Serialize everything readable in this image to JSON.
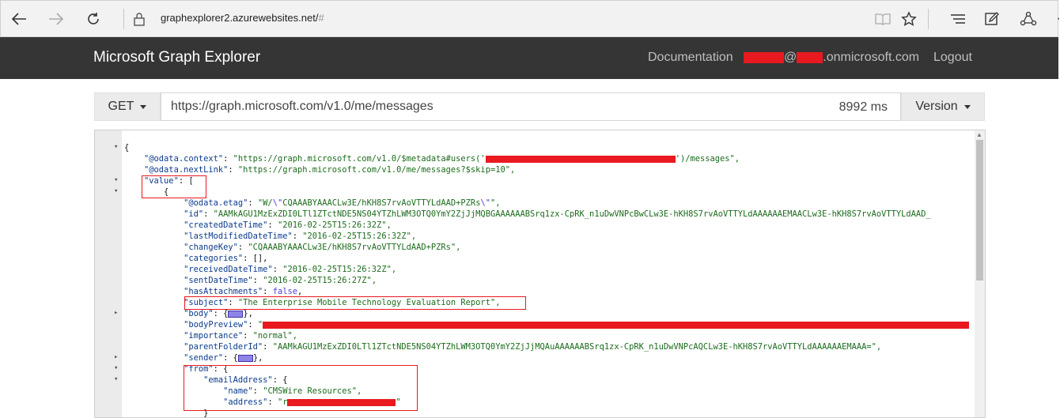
{
  "browser": {
    "url_host": "graphexplorer2.azurewebsites.net/",
    "url_hash": "#"
  },
  "header": {
    "brand": "Microsoft Graph Explorer",
    "documentation": "Documentation",
    "user_at": "@",
    "user_domain": ".onmicrosoft.com",
    "logout": "Logout"
  },
  "query": {
    "method": "GET",
    "url": "https://graph.microsoft.com/v1.0/me/messages",
    "timing": "8992 ms",
    "version": "Version"
  },
  "colors": {
    "header_bg": "#353535",
    "redaction": "#e8191f",
    "annotation": "#e8191f"
  },
  "json": {
    "open_brace": "{",
    "context_key": "\"@odata.context\"",
    "context_val_a": "\"https://graph.microsoft.com/v1.0/$metadata#users('",
    "context_val_b": "')/messages\",",
    "nextlink_key": "\"@odata.nextLink\"",
    "nextlink_val": "\"https://graph.microsoft.com/v1.0/me/messages?$skip=10\",",
    "value_key": "\"value\"",
    "value_open": ": [",
    "item_open": "{",
    "etag_key": "\"@odata.etag\"",
    "etag_val_a": "\"W/",
    "etag_val_b": "\\\"",
    "etag_val_c": "CQAAABYAAACLw3E/hKH8S7rvAoVTTYLdAAD+PZRs",
    "etag_val_d": "\\\"",
    "etag_val_e": "\",",
    "id_key": "\"id\"",
    "id_val": "\"AAMkAGU1MzExZDI0LTl1ZTctNDE5NS04YTZhLWM3OTQ0YmY2ZjJjMQBGAAAAAABSrq1zx-CpRK_n1uDwVNPcBwCLw3E-hKH8S7rvAoVTTYLdAAAAAAEMAACLw3E-hKH8S7rvAoVTTYLdAAD_",
    "created_key": "\"createdDateTime\"",
    "created_val": "\"2016-02-25T15:26:32Z\",",
    "modified_key": "\"lastModifiedDateTime\"",
    "modified_val": "\"2016-02-25T15:26:32Z\",",
    "changekey_key": "\"changeKey\"",
    "changekey_val": "\"CQAAABYAAACLw3E/hKH8S7rvAoVTTYLdAAD+PZRs\",",
    "categories_key": "\"categories\"",
    "categories_val": "[],",
    "received_key": "\"receivedDateTime\"",
    "received_val": "\"2016-02-25T15:26:32Z\",",
    "sent_key": "\"sentDateTime\"",
    "sent_val": "\"2016-02-25T15:26:27Z\",",
    "attach_key": "\"hasAttachments\"",
    "attach_val": "false",
    "subject_key": "\"subject\"",
    "subject_val": "\"The Enterprise Mobile Technology Evaluation Report\",",
    "body_key": "\"body\"",
    "preview_key": "\"bodyPreview\"",
    "preview_val": "\"",
    "importance_key": "\"importance\"",
    "importance_val": "\"normal\",",
    "parent_key": "\"parentFolderId\"",
    "parent_val": "\"AAMkAGU1MzExZDI0LTl1ZTctNDE5NS04YTZhLWM3OTQ0YmY2ZjJjMQAuAAAAAABSrq1zx-CpRK_n1uDwVNPcAQCLw3E-hKH8S7rvAoVTTYLdAAAAAAEMAAA=\",",
    "sender_key": "\"sender\"",
    "from_key": "\"from\"",
    "email_key": "\"emailAddress\"",
    "name_key": "\"name\"",
    "name_val": "\"CMSWire Resources\",",
    "address_key": "\"address\"",
    "address_val_a": "\"r",
    "address_val_b": "\"",
    "close_brace": "}"
  }
}
